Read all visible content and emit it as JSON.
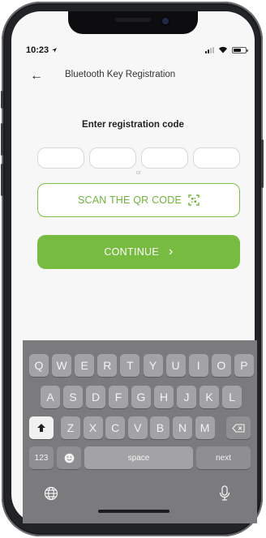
{
  "status_bar": {
    "time": "10:23"
  },
  "nav": {
    "back_icon": "←",
    "title": "Bluetooth Key Registration"
  },
  "registration": {
    "label": "Enter registration code",
    "separator": "or",
    "scan_label": "SCAN THE QR CODE",
    "continue_label": "CONTINUE",
    "continue_icon": "›",
    "accent_color": "#77bc40"
  },
  "keyboard": {
    "row1": [
      "Q",
      "W",
      "E",
      "R",
      "T",
      "Y",
      "U",
      "I",
      "O",
      "P"
    ],
    "row2": [
      "A",
      "S",
      "D",
      "F",
      "G",
      "H",
      "J",
      "K",
      "L"
    ],
    "row3": [
      "Z",
      "X",
      "C",
      "V",
      "B",
      "N",
      "M"
    ],
    "numbers_label": "123",
    "space_label": "space",
    "next_label": "next"
  }
}
